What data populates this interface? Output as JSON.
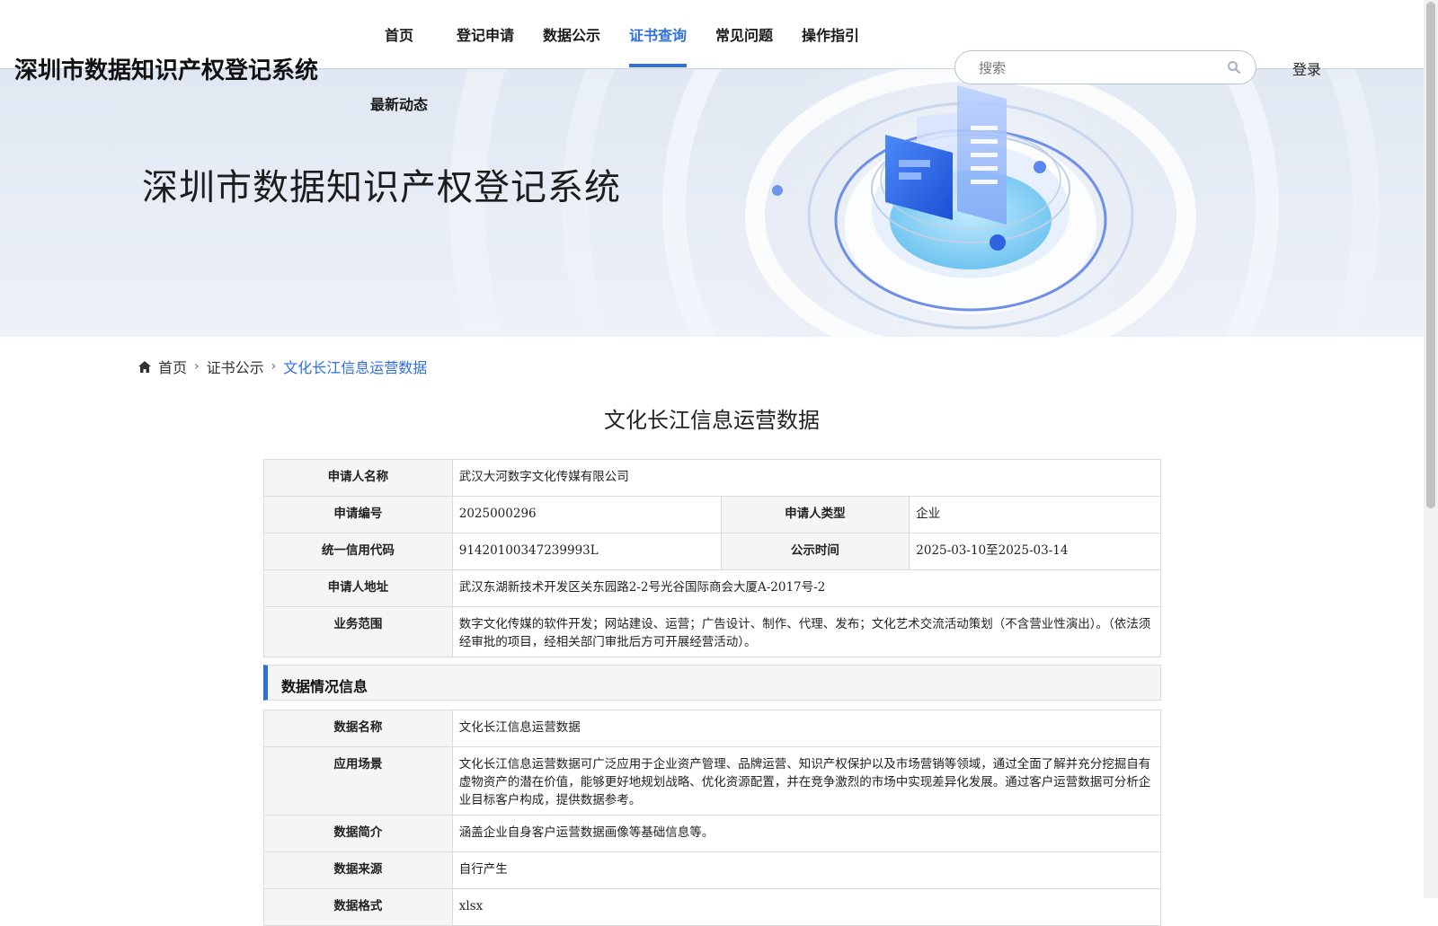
{
  "header": {
    "site_title": "深圳市数据知识产权登记系统",
    "nav": [
      "首页",
      "登记申请",
      "数据公示",
      "证书查询",
      "常见问题",
      "操作指引"
    ],
    "nav_second_row": "最新动态",
    "active_nav": "证书查询",
    "search_placeholder": "搜索",
    "login_label": "登录"
  },
  "hero": {
    "title": "深圳市数据知识产权登记系统"
  },
  "breadcrumb": {
    "home": "首页",
    "level1": "证书公示",
    "current": "文化长江信息运营数据"
  },
  "detail": {
    "title": "文化长江信息运营数据",
    "applicant": {
      "name_label": "申请人名称",
      "name": "武汉大河数字文化传媒有限公司",
      "number_label": "申请编号",
      "number": "2025000296",
      "type_label": "申请人类型",
      "type": "企业",
      "credit_label": "统一信用代码",
      "credit": "91420100347239993L",
      "publish_label": "公示时间",
      "publish": "2025-03-10至2025-03-14",
      "address_label": "申请人地址",
      "address": "武汉东湖新技术开发区关东园路2-2号光谷国际商会大厦A-2017号-2",
      "scope_label": "业务范围",
      "scope": "数字文化传媒的软件开发；网站建设、运营；广告设计、制作、代理、发布；文化艺术交流活动策划（不含营业性演出）。（依法须经审批的项目，经相关部门审批后方可开展经营活动）。"
    },
    "section_title": "数据情况信息",
    "data_info": {
      "data_name_label": "数据名称",
      "data_name": "文化长江信息运营数据",
      "scene_label": "应用场景",
      "scene": "文化长江信息运营数据可广泛应用于企业资产管理、品牌运营、知识产权保护以及市场营销等领域，通过全面了解并充分挖掘自有虚物资产的潜在价值，能够更好地规划战略、优化资源配置，并在竞争激烈的市场中实现差异化发展。通过客户运营数据可分析企业目标客户构成，提供数据参考。",
      "intro_label": "数据简介",
      "intro": "涵盖企业自身客户运营数据画像等基础信息等。",
      "source_label": "数据来源",
      "source": "自行产生",
      "format_label": "数据格式",
      "format": "xlsx"
    }
  },
  "colors": {
    "accent": "#2f6fde",
    "label_bg": "#f5f5f5",
    "border": "#dcdcdc"
  }
}
